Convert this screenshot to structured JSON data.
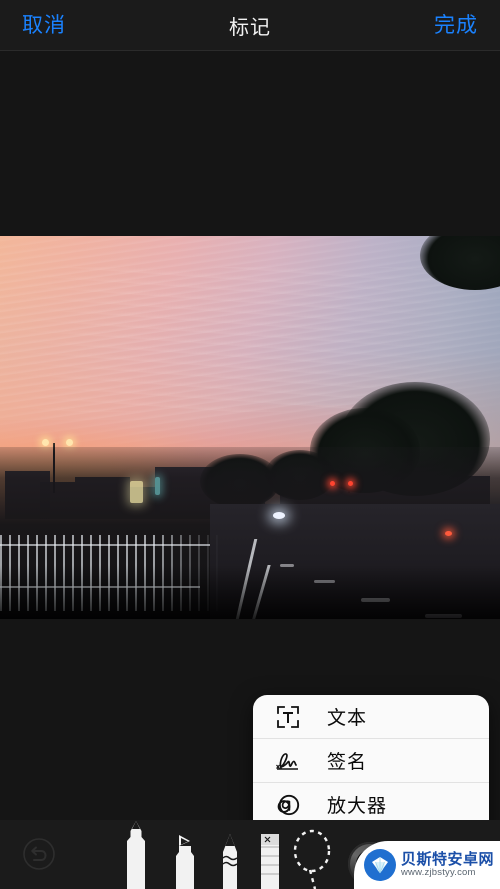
{
  "navbar": {
    "cancel_label": "取消",
    "title": "标记",
    "done_label": "完成",
    "accent_color": "#1a82ff",
    "title_color": "#f2f2f2",
    "background_color": "#1b1b1b"
  },
  "canvas": {
    "background_color": "#151515",
    "photo": {
      "description": "城市黄昏街景照片",
      "sky_colors": [
        "#f3b79a",
        "#e9b0b0",
        "#bdb2c8",
        "#8a9cb6"
      ],
      "glow_color": "#ffb060",
      "road_color": "#26242a"
    }
  },
  "popup_menu": {
    "background_color": "#fafafa",
    "items": [
      {
        "icon": "text-box-icon",
        "label": "文本"
      },
      {
        "icon": "signature-icon",
        "label": "签名"
      },
      {
        "icon": "magnifier-icon",
        "label": "放大器"
      }
    ],
    "shapes": [
      {
        "icon": "square-shape-icon",
        "name": "square"
      },
      {
        "icon": "circle-shape-icon",
        "name": "circle"
      },
      {
        "icon": "speech-bubble-shape-icon",
        "name": "speech-bubble"
      },
      {
        "icon": "arrow-shape-icon",
        "name": "arrow"
      }
    ]
  },
  "toolbar": {
    "background_color": "#1b1b1b",
    "undo": {
      "icon": "undo-icon",
      "enabled": false
    },
    "tools": [
      {
        "icon": "pen-tool-icon",
        "name": "pen",
        "selected": true
      },
      {
        "icon": "marker-tool-icon",
        "name": "marker",
        "selected": false
      },
      {
        "icon": "pencil-tool-icon",
        "name": "pencil",
        "selected": false
      },
      {
        "icon": "eraser-tool-icon",
        "name": "eraser",
        "selected": false
      },
      {
        "icon": "lasso-tool-icon",
        "name": "lasso",
        "selected": false
      }
    ],
    "color_wheel": {
      "icon": "color-wheel-icon",
      "current_color": "#000000"
    }
  },
  "watermark": {
    "title": "贝斯特安卓网",
    "url": "www.zjbstyy.com",
    "logo_color": "#1f6fd0",
    "title_color": "#1b4fa8"
  }
}
